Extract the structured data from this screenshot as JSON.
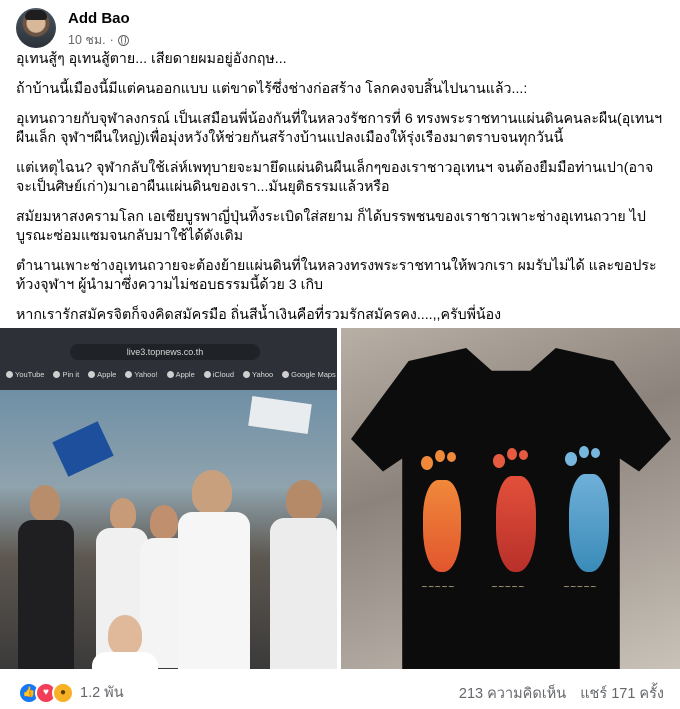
{
  "post": {
    "author": "Add Bao",
    "time": "10 ชม.",
    "separator": "·",
    "paragraphs": [
      "อุเทนสู้ๆ อุเทนสู้ตาย... เสียดายผมอยู่อังกฤษ...",
      "ถ้าบ้านนี้เมืองนี้มีแต่คนออกแบบ แต่ขาดไร้ซึ่งช่างก่อสร้าง โลกคงจบสิ้นไปนานแล้ว...:",
      "อุเทนถวายกับจุฬาลงกรณ์ เป็นเสมือนพี่น้องกันที่ในหลวงรัชการที่ 6 ทรงพระราชทานแผ่นดินคนละผืน(อุเทนฯผืนเล็ก จุฬาฯผืนใหญ่)เพื่อมุ่งหวังให้ช่วยกันสร้างบ้านแปลงเมืองให้รุ่งเรืองมาตราบจนทุกวันนี้",
      "แต่เหตุไฉน? จุฬากลับใช้เล่ห์เพทุบายจะมายึดแผ่นดินผืนเล็กๆของเราชาวอุเทนฯ จนต้องยืมมือท่านเปา(อาจจะเป็นศิษย์เก่า)มาเอาผืนแผ่นดินของเรา...มันยุติธรรมแล้วหรือ",
      "สมัยมหาสงครามโลก เอเซียบูรพาญี่ปุ่นทิ้งระเบิดใส่สยาม ก็ได้บรรพชนของเราชาวเพาะช่างอุเทนถวาย ไปบูรณะซ่อมแซมจนกลับมาใช้ได้ดังเดิม",
      "ตำนานเพาะช่างอุเทนถวายจะต้องย้ายแผ่นดินที่ในหลวงทรงพระราชทานให้พวกเรา  ผมรับไม่ได้ และขอประท้วงจุฬาฯ ผู้นำมาซึ่งความไม่ชอบธรรมนี้ด้วย 3 เกิบ",
      "หากเรารักสมัครจิตก็จงคิดสมัครมือ ถิ่นสีน้ำเงินคือที่รวมรักสมัครคง....,,ครับพี่น้อง"
    ]
  },
  "left_image": {
    "url": "live3.topnews.co.th",
    "bookmarks": [
      "YouTube",
      "Pin it",
      "Apple",
      "Yahoo!",
      "Apple",
      "iCloud",
      "Yahoo",
      "Google Maps"
    ]
  },
  "right_image": {
    "signatures": [
      "Thai signature",
      "Thai signature",
      "Thai signature"
    ]
  },
  "footer": {
    "reactions": [
      "like-icon",
      "love-icon",
      "wow-icon"
    ],
    "reaction_count": "1.2 พัน",
    "comments": "213 ความคิดเห็น",
    "shares": "แชร์ 171 ครั้ง"
  },
  "colors": {
    "like": "#1877f2",
    "love": "#f33e58",
    "wow": "#f7b125",
    "secondary_text": "#65676b"
  }
}
